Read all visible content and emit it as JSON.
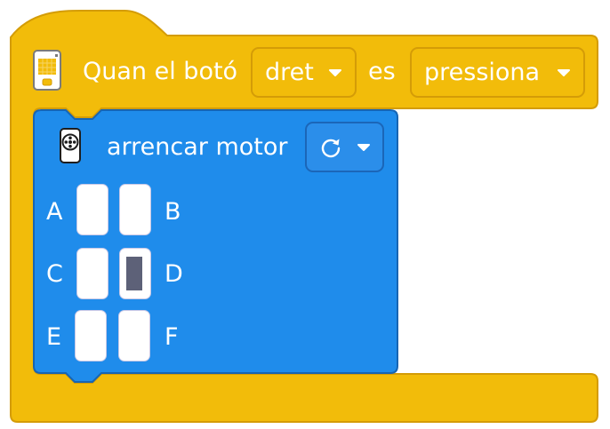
{
  "colors": {
    "hat_block": "#f2bc0a",
    "hat_block_border": "#d49c07",
    "motor_block": "#1f8ceb",
    "motor_block_border": "#1765b3",
    "port_selected": "#5d6178"
  },
  "hat_block": {
    "icon": "hub-icon",
    "label_when": "Quan el botó",
    "button_dropdown": {
      "value": "dret",
      "icon": "caret-down-icon"
    },
    "label_is": "es",
    "state_dropdown": {
      "value": "pressiona",
      "icon": "caret-down-icon"
    }
  },
  "motor_block": {
    "icon": "motor-icon",
    "label": "arrencar motor",
    "direction_dropdown": {
      "icon": "rotate-clockwise-icon",
      "caret": "caret-down-icon"
    },
    "ports": [
      {
        "label": "A",
        "selected": false
      },
      {
        "label": "B",
        "selected": false
      },
      {
        "label": "C",
        "selected": false
      },
      {
        "label": "D",
        "selected": true
      },
      {
        "label": "E",
        "selected": false
      },
      {
        "label": "F",
        "selected": false
      }
    ]
  }
}
